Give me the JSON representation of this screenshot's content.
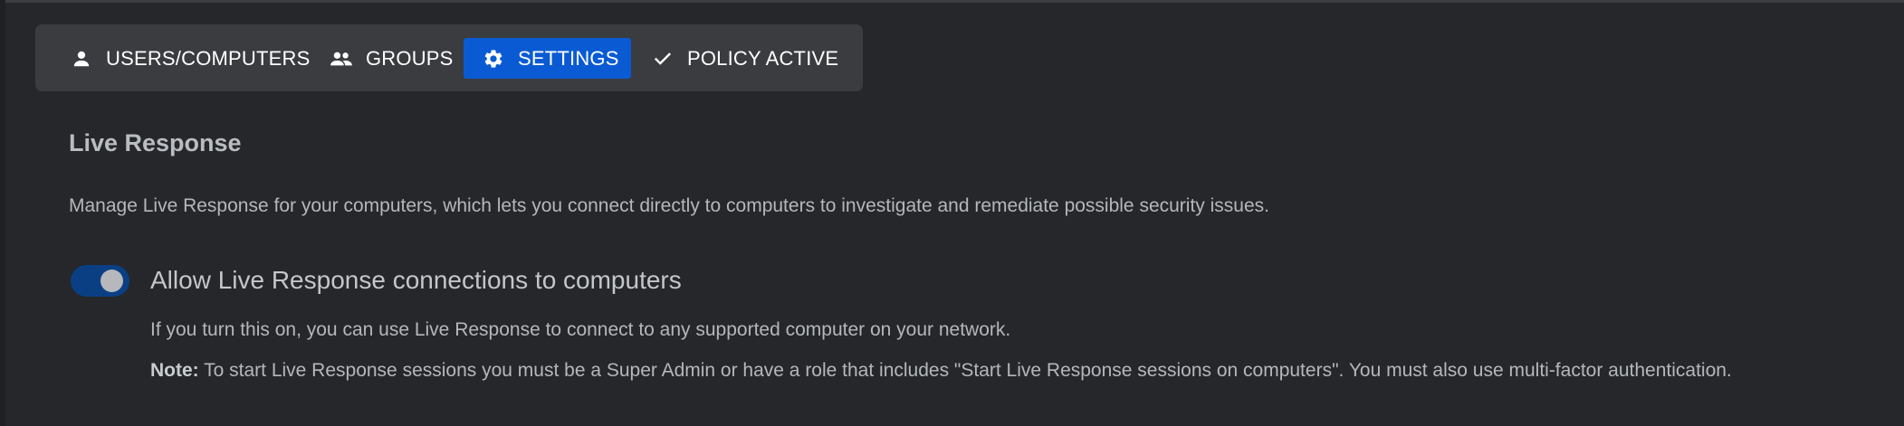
{
  "tabs": {
    "users": {
      "label": "USERS/COMPUTERS",
      "icon": "person-icon"
    },
    "groups": {
      "label": "GROUPS",
      "icon": "group-icon"
    },
    "settings": {
      "label": "SETTINGS",
      "icon": "gear-icon",
      "active": true
    },
    "policy": {
      "label": "POLICY ACTIVE",
      "icon": "check-icon"
    }
  },
  "live_response": {
    "title": "Live Response",
    "description": "Manage Live Response for your computers, which lets you connect directly to computers to investigate and remediate possible security issues.",
    "toggle": {
      "label": "Allow Live Response connections to computers",
      "state": "on"
    },
    "help": "If you turn this on, you can use Live Response to connect to any supported computer on your network.",
    "note_label": "Note:",
    "note_body": " To start Live Response sessions you must be a Super Admin or have a role that includes \"Start Live Response sessions on computers\". You must also use multi-factor authentication."
  },
  "colors": {
    "background": "#25272a",
    "tabbar": "#3a3c40",
    "active_tab": "#0a5bd3",
    "toggle_on": "#0b3f84"
  }
}
